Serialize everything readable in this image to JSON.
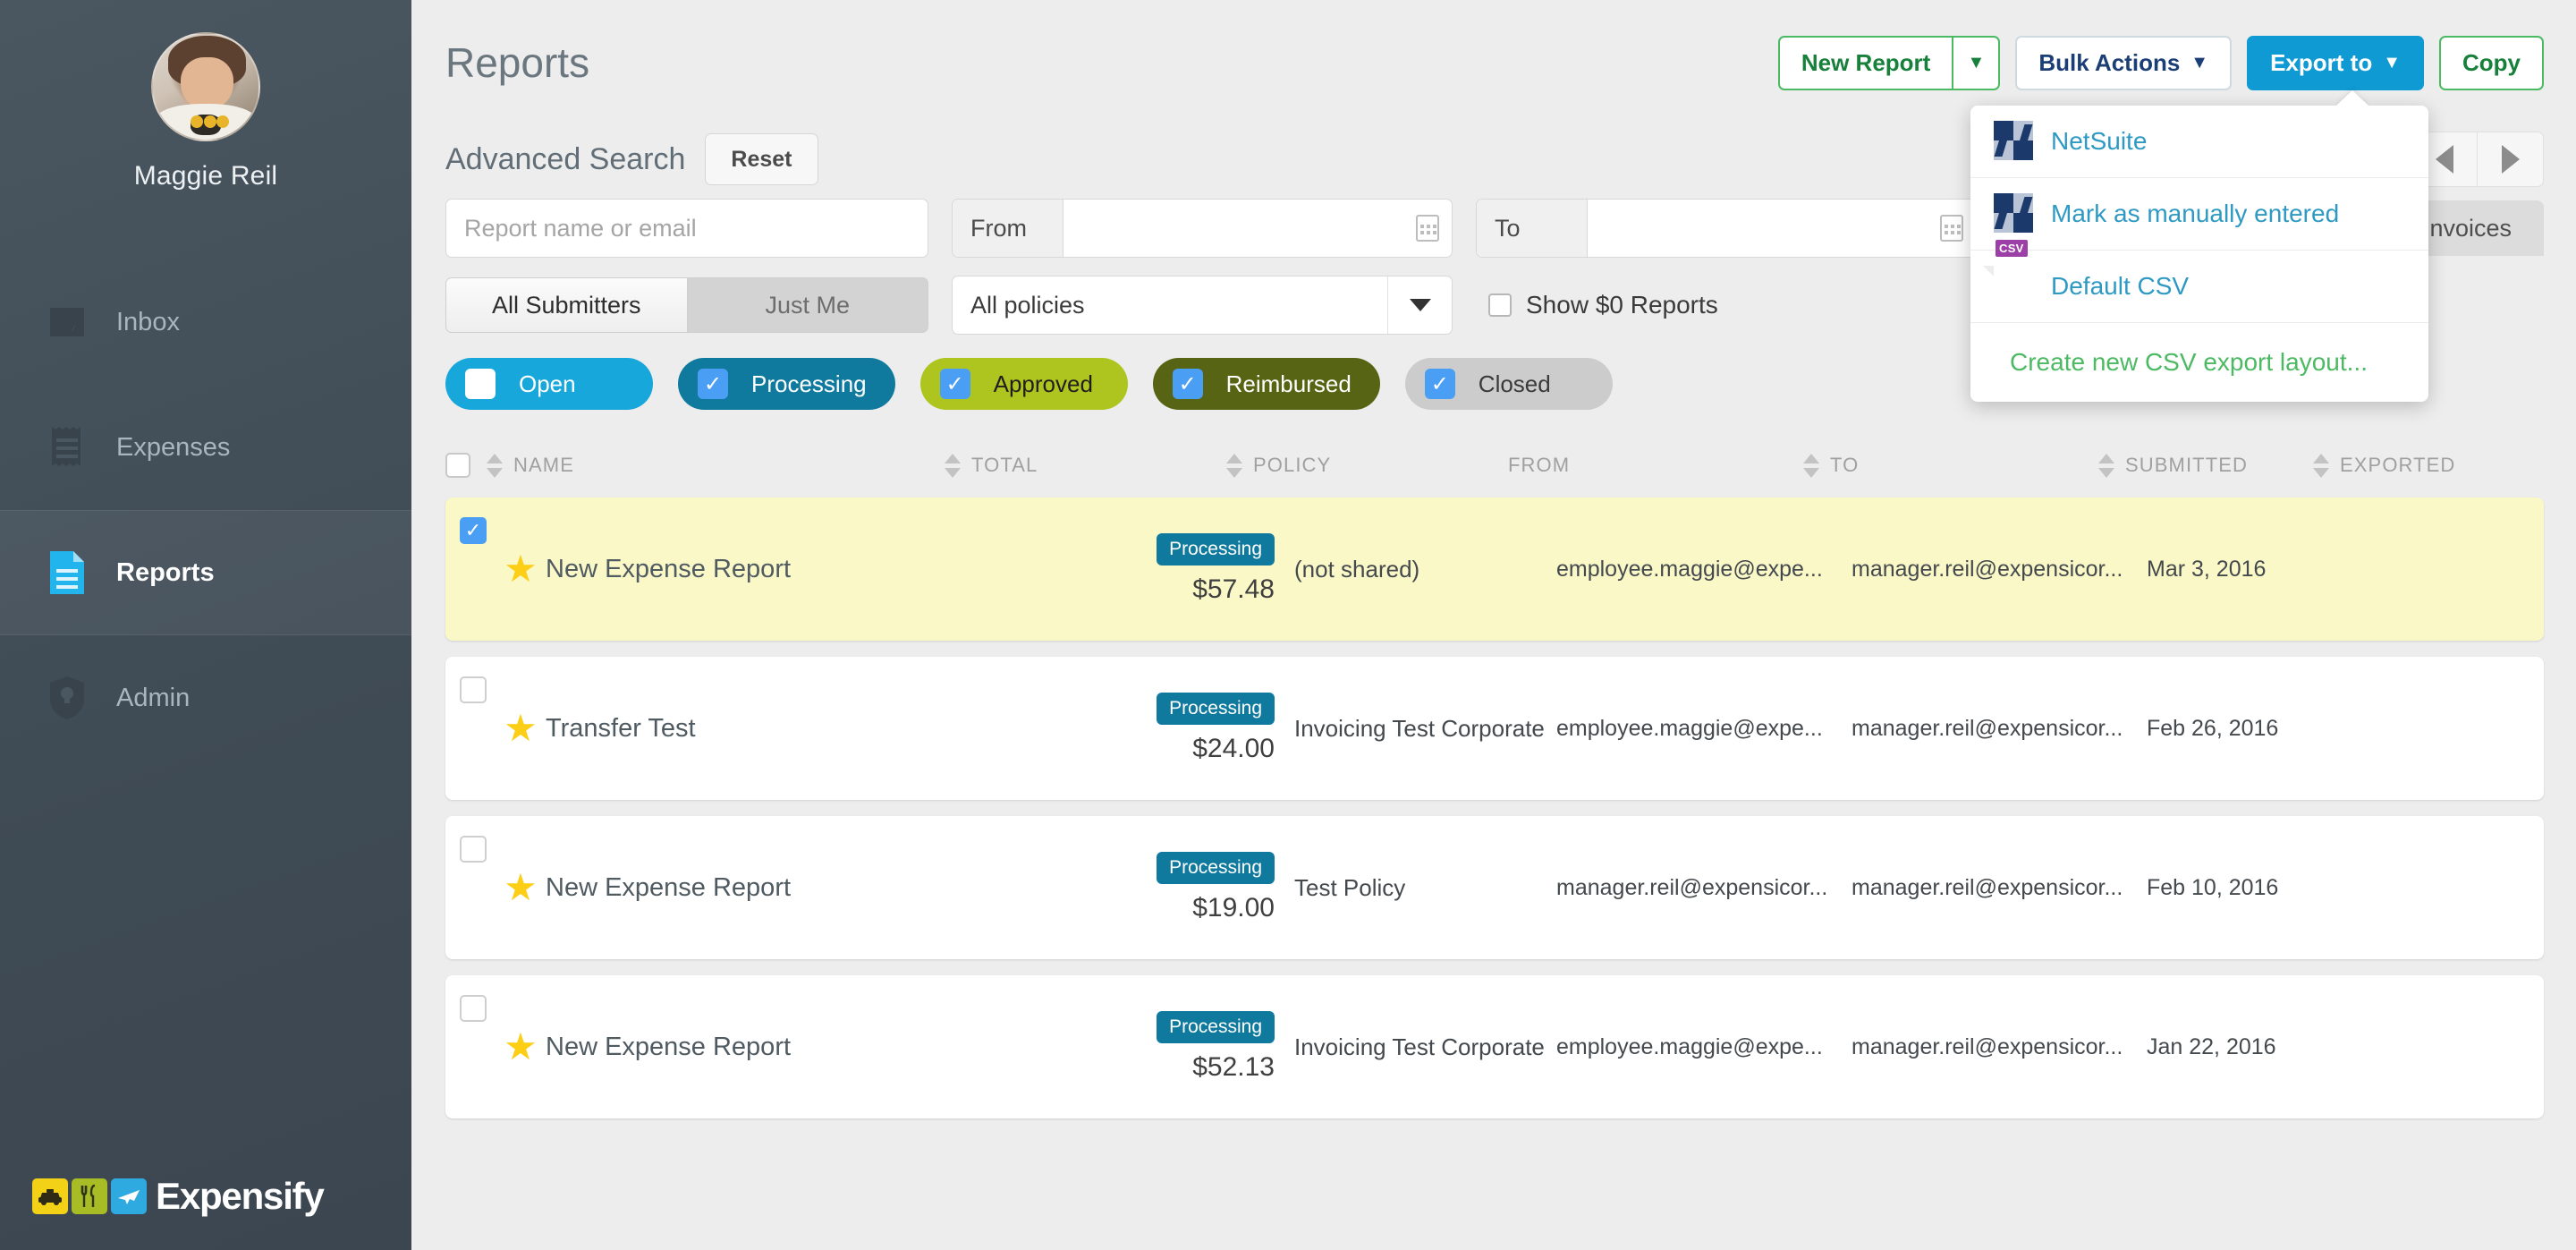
{
  "sidebar": {
    "user_name": "Maggie Reil",
    "items": [
      {
        "label": "Inbox",
        "icon": "inbox-icon",
        "active": false
      },
      {
        "label": "Expenses",
        "icon": "receipt-icon",
        "active": false
      },
      {
        "label": "Reports",
        "icon": "document-icon",
        "active": true
      },
      {
        "label": "Admin",
        "icon": "shield-icon",
        "active": false
      }
    ],
    "brand": "Expensify"
  },
  "header": {
    "title": "Reports",
    "new_report_label": "New Report",
    "bulk_actions_label": "Bulk Actions",
    "export_to_label": "Export to",
    "copy_label": "Copy",
    "caret_glyph": "▼"
  },
  "export_dropdown": {
    "items": [
      {
        "label": "NetSuite",
        "icon": "netsuite-icon",
        "style": "blue"
      },
      {
        "label": "Mark as manually entered",
        "icon": "netsuite-icon",
        "style": "blue"
      },
      {
        "label": "Default CSV",
        "icon": "csv-file-icon",
        "style": "blue"
      },
      {
        "label": "Create new CSV export layout...",
        "icon": "none",
        "style": "green"
      }
    ],
    "csv_tag": "CSV"
  },
  "search": {
    "title": "Advanced Search",
    "reset_label": "Reset",
    "name_placeholder": "Report name or email",
    "name_value": "",
    "from_label": "From",
    "from_value": "",
    "to_label": "To",
    "to_value": "",
    "submitters_all": "All Submitters",
    "submitters_just_me": "Just Me",
    "policy_selected": "All policies",
    "show_zero_label": "Show $0 Reports",
    "show_zero_checked": false,
    "invoices_tab": "Invoices"
  },
  "status_pills": [
    {
      "label": "Open",
      "checked": false,
      "color": "#18a7db"
    },
    {
      "label": "Processing",
      "checked": true,
      "color": "#107a9e"
    },
    {
      "label": "Approved",
      "checked": true,
      "color": "#aec41f"
    },
    {
      "label": "Reimbursed",
      "checked": true,
      "color": "#566413"
    },
    {
      "label": "Closed",
      "checked": true,
      "color": "#cccccc"
    }
  ],
  "table": {
    "columns": [
      "NAME",
      "TOTAL",
      "POLICY",
      "FROM",
      "TO",
      "SUBMITTED",
      "EXPORTED"
    ],
    "rows": [
      {
        "selected": true,
        "starred": true,
        "name": "New Expense Report",
        "status": "Processing",
        "total": "$57.48",
        "policy": "(not shared)",
        "from": "employee.maggie@expe...",
        "to": "manager.reil@expensicor...",
        "submitted": "Mar 3, 2016",
        "exported": ""
      },
      {
        "selected": false,
        "starred": true,
        "name": "Transfer Test",
        "status": "Processing",
        "total": "$24.00",
        "policy": "Invoicing Test Corporate",
        "from": "employee.maggie@expe...",
        "to": "manager.reil@expensicor...",
        "submitted": "Feb 26, 2016",
        "exported": ""
      },
      {
        "selected": false,
        "starred": true,
        "name": "New Expense Report",
        "status": "Processing",
        "total": "$19.00",
        "policy": "Test Policy",
        "from": "manager.reil@expensicor...",
        "to": "manager.reil@expensicor...",
        "submitted": "Feb 10, 2016",
        "exported": ""
      },
      {
        "selected": false,
        "starred": true,
        "name": "New Expense Report",
        "status": "Processing",
        "total": "$52.13",
        "policy": "Invoicing Test Corporate",
        "from": "employee.maggie@expe...",
        "to": "manager.reil@expensicor...",
        "submitted": "Jan 22, 2016",
        "exported": ""
      }
    ]
  },
  "colors": {
    "accent_blue": "#0f9ad4",
    "green": "#4cb963",
    "processing": "#107a9e",
    "selected_row": "#fbf8c8",
    "star": "#fcce15",
    "sidebar": "#3f4b55"
  }
}
